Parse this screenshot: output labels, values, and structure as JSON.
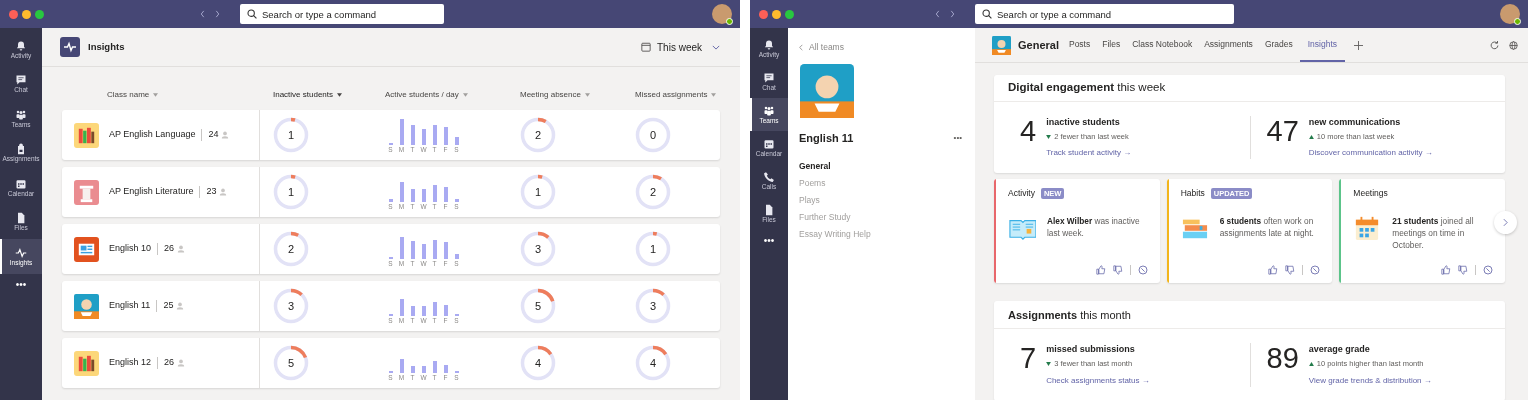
{
  "left_window": {
    "search": {
      "placeholder": "Search or type a command"
    },
    "app_bar": [
      {
        "label": "Activity",
        "kind": "bell",
        "selected": false
      },
      {
        "label": "Chat",
        "kind": "chat",
        "selected": false
      },
      {
        "label": "Teams",
        "kind": "teams",
        "selected": false
      },
      {
        "label": "Assignments",
        "kind": "backpack",
        "selected": false
      },
      {
        "label": "Calendar",
        "kind": "calendar",
        "selected": false
      },
      {
        "label": "Files",
        "kind": "file",
        "selected": false
      },
      {
        "label": "Insights",
        "kind": "pulse",
        "selected": true
      }
    ],
    "more": "•••",
    "header": {
      "title": "Insights",
      "period": "This week"
    },
    "columns": [
      {
        "label": "Class name",
        "sorted": false
      },
      {
        "label": "Inactive students",
        "sorted": true
      },
      {
        "label": "Active students / day",
        "sorted": false
      },
      {
        "label": "Meeting absence",
        "sorted": false
      },
      {
        "label": "Missed assignments",
        "sorted": false
      }
    ],
    "rows": [
      {
        "class": "AP English Language",
        "members": "24",
        "kind": "books",
        "inactive": {
          "value": "1"
        },
        "days": [
          "S",
          "M",
          "T",
          "W",
          "T",
          "F",
          "S"
        ],
        "meeting_absence": {
          "value": "2"
        },
        "missed_assignments": {
          "value": "0"
        }
      },
      {
        "class": "AP English Literature",
        "members": "23",
        "kind": "pillar",
        "inactive": {
          "value": "1"
        },
        "days": [
          "S",
          "M",
          "T",
          "W",
          "T",
          "F",
          "S"
        ],
        "meeting_absence": {
          "value": "1"
        },
        "missed_assignments": {
          "value": "2"
        }
      },
      {
        "class": "English 10",
        "members": "26",
        "kind": "newspaper",
        "inactive": {
          "value": "2"
        },
        "days": [
          "S",
          "M",
          "T",
          "W",
          "T",
          "F",
          "S"
        ],
        "meeting_absence": {
          "value": "3"
        },
        "missed_assignments": {
          "value": "1"
        }
      },
      {
        "class": "English 11",
        "members": "25",
        "kind": "portrait",
        "inactive": {
          "value": "3"
        },
        "days": [
          "S",
          "M",
          "T",
          "W",
          "T",
          "F",
          "S"
        ],
        "meeting_absence": {
          "value": "5"
        },
        "missed_assignments": {
          "value": "3"
        }
      },
      {
        "class": "English 12",
        "members": "26",
        "kind": "books",
        "inactive": {
          "value": "5"
        },
        "days": [
          "S",
          "M",
          "T",
          "W",
          "T",
          "F",
          "S"
        ],
        "meeting_absence": {
          "value": "4"
        },
        "missed_assignments": {
          "value": "4"
        }
      }
    ]
  },
  "right_window": {
    "search": {
      "placeholder": "Search or type a command"
    },
    "app_bar": [
      {
        "label": "Activity",
        "kind": "bell",
        "selected": false
      },
      {
        "label": "Chat",
        "kind": "chat",
        "selected": false
      },
      {
        "label": "Teams",
        "kind": "teams",
        "selected": true
      },
      {
        "label": "Calendar",
        "kind": "calendar",
        "selected": false
      },
      {
        "label": "Calls",
        "kind": "phone",
        "selected": false
      },
      {
        "label": "Files",
        "kind": "file",
        "selected": false
      }
    ],
    "more": "•••",
    "team_panel": {
      "back": "All teams",
      "team": "English 11",
      "more": "•••",
      "channels": [
        {
          "label": "General",
          "selected": true
        },
        {
          "label": "Poems",
          "selected": false
        },
        {
          "label": "Plays",
          "selected": false
        },
        {
          "label": "Further Study",
          "selected": false
        },
        {
          "label": "Essay Writing Help",
          "selected": false
        }
      ]
    },
    "channel_title": "General",
    "tabs": [
      {
        "label": "Posts",
        "selected": false
      },
      {
        "label": "Files",
        "selected": false
      },
      {
        "label": "Class Notebook",
        "selected": false
      },
      {
        "label": "Assignments",
        "selected": false
      },
      {
        "label": "Grades",
        "selected": false
      },
      {
        "label": "Insights",
        "selected": true
      }
    ],
    "engagement": {
      "title": "**Digital engagement** this week",
      "stats": [
        {
          "value": "4",
          "label": "inactive students",
          "kind": "down",
          "change": "2 fewer than last week",
          "link": "Track student activity →"
        },
        {
          "value": "47",
          "label": "new communications",
          "kind": "up",
          "change": "10 more than last week",
          "link": "Discover communication activity →"
        }
      ]
    },
    "cards": [
      {
        "title": "Activity",
        "badge": "NEW",
        "color": "#e8676b",
        "kind": "book",
        "text": "**Alex Wilber** was inactive last week."
      },
      {
        "title": "Habits",
        "badge": "UPDATED",
        "color": "#f2b51c",
        "kind": "books",
        "text": "**6 students** often work on assignments late at night."
      },
      {
        "title": "Meetings",
        "color": "#5cc48a",
        "kind": "calendar",
        "text": "**21 students** joined all meetings on time in October."
      }
    ],
    "assignments": {
      "title": "**Assignments** this month",
      "stats": [
        {
          "value": "7",
          "label": "missed submissions",
          "kind": "down",
          "change": "3 fewer than last month",
          "link": "Check assignments status →"
        },
        {
          "value": "89",
          "label": "average grade",
          "kind": "up",
          "change": "10 points higher than last month",
          "link": "View grade trends & distribution →"
        }
      ]
    }
  }
}
